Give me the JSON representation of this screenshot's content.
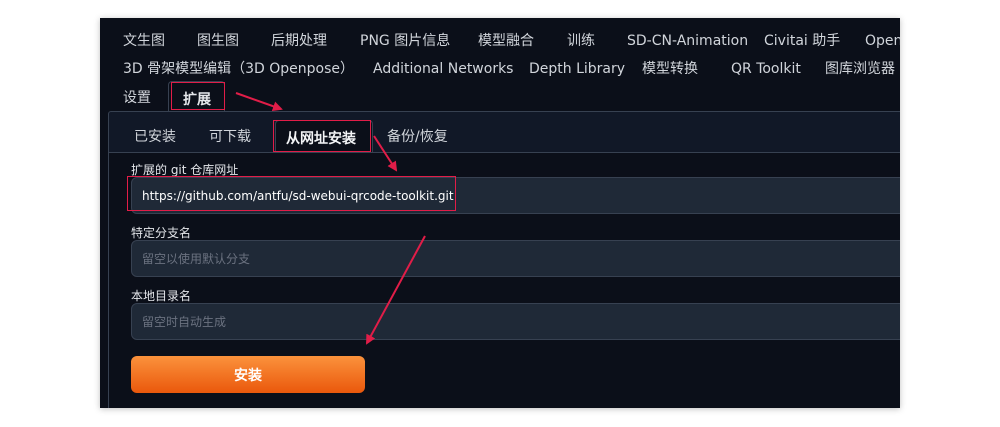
{
  "top_tabs": {
    "row1": [
      "文生图",
      "图生图",
      "后期处理",
      "PNG 图片信息",
      "模型融合",
      "训练",
      "SD-CN-Animation",
      "Civitai 助手",
      "Open"
    ],
    "row2": [
      "3D 骨架模型编辑（3D Openpose）",
      "Additional Networks",
      "Depth Library",
      "模型转换",
      "QR Toolkit",
      "图库浏览器"
    ],
    "row3": [
      "设置"
    ],
    "active": "扩展"
  },
  "sub_tabs": {
    "items": [
      "已安装",
      "可下载",
      "备份/恢复"
    ],
    "active": "从网址安装"
  },
  "form": {
    "url_label": "扩展的 git 仓库网址",
    "url_value": "https://github.com/antfu/sd-webui-qrcode-toolkit.git",
    "branch_label": "特定分支名",
    "branch_placeholder": "留空以使用默认分支",
    "dir_label": "本地目录名",
    "dir_placeholder": "留空时自动生成",
    "install_label": "安装"
  },
  "colors": {
    "background": "#0b0f19",
    "panel": "#111827",
    "input": "#1f2937",
    "accent_orange": "#ea580c",
    "annotation_red": "#e11d48"
  }
}
